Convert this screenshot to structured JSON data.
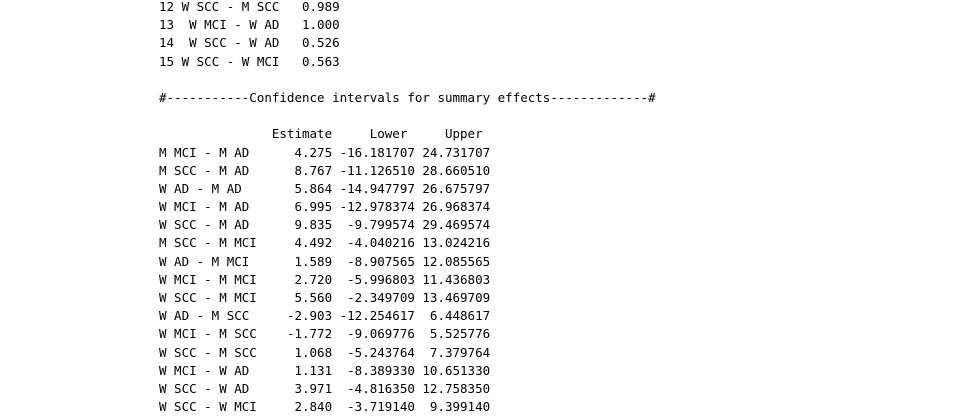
{
  "top_rows": [
    {
      "text": "12 W SCC - M SCC   0.989"
    },
    {
      "text": "13  W MCI - W AD   1.000"
    },
    {
      "text": "14  W SCC - W AD   0.526"
    },
    {
      "text": "15 W SCC - W MCI   0.563"
    }
  ],
  "section_header": "#-----------Confidence intervals for summary effects-------------#",
  "ci_header": "               Estimate     Lower     Upper",
  "ci_rows": [
    {
      "text": "M MCI - M AD      4.275 -16.181707 24.731707"
    },
    {
      "text": "M SCC - M AD      8.767 -11.126510 28.660510"
    },
    {
      "text": "W AD - M AD       5.864 -14.947797 26.675797"
    },
    {
      "text": "W MCI - M AD      6.995 -12.978374 26.968374"
    },
    {
      "text": "W SCC - M AD      9.835  -9.799574 29.469574"
    },
    {
      "text": "M SCC - M MCI     4.492  -4.040216 13.024216"
    },
    {
      "text": "W AD - M MCI      1.589  -8.907565 12.085565"
    },
    {
      "text": "W MCI - M MCI     2.720  -5.996803 11.436803"
    },
    {
      "text": "W SCC - M MCI     5.560  -2.349709 13.469709"
    },
    {
      "text": "W AD - M SCC     -2.903 -12.254617  6.448617"
    },
    {
      "text": "W MCI - M SCC    -1.772  -9.069776  5.525776"
    },
    {
      "text": "W SCC - M SCC     1.068  -5.243764  7.379764"
    },
    {
      "text": "W MCI - W AD      1.131  -8.389330 10.651330"
    },
    {
      "text": "W SCC - W AD      3.971  -4.816350 12.758350"
    },
    {
      "text": "W SCC - W MCI     2.840  -3.719140  9.399140"
    }
  ]
}
